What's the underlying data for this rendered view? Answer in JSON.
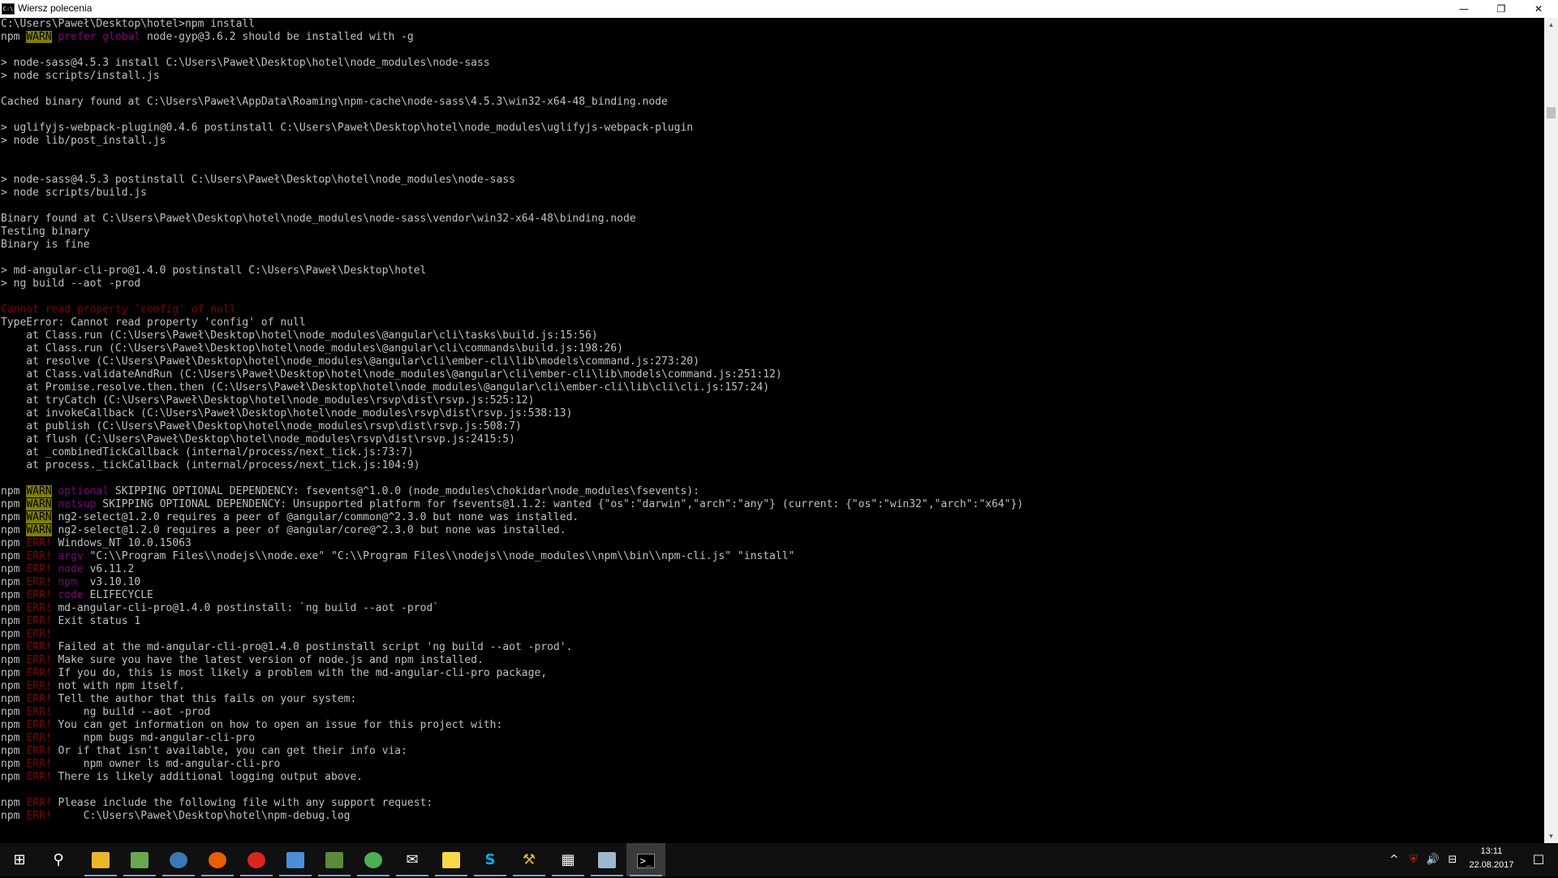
{
  "window": {
    "title": "Wiersz polecenia",
    "icon_text": "C:\\",
    "minimize_glyph": "—",
    "restore_glyph": "❐",
    "close_glyph": "✕"
  },
  "console_lines": [
    [
      {
        "t": "C:\\Users\\Paweł\\Desktop\\hotel>npm install"
      }
    ],
    [
      {
        "t": "npm "
      },
      {
        "t": "WARN",
        "c": "warn"
      },
      {
        "t": " prefer global",
        "c": "mag"
      },
      {
        "t": " node-gyp@3.6.2 should be installed with -g"
      }
    ],
    [
      {
        "t": ""
      }
    ],
    [
      {
        "t": "> node-sass@4.5.3 install C:\\Users\\Paweł\\Desktop\\hotel\\node_modules\\node-sass"
      }
    ],
    [
      {
        "t": "> node scripts/install.js"
      }
    ],
    [
      {
        "t": ""
      }
    ],
    [
      {
        "t": "Cached binary found at C:\\Users\\Paweł\\AppData\\Roaming\\npm-cache\\node-sass\\4.5.3\\win32-x64-48_binding.node"
      }
    ],
    [
      {
        "t": ""
      }
    ],
    [
      {
        "t": "> uglifyjs-webpack-plugin@0.4.6 postinstall C:\\Users\\Paweł\\Desktop\\hotel\\node_modules\\uglifyjs-webpack-plugin"
      }
    ],
    [
      {
        "t": "> node lib/post_install.js"
      }
    ],
    [
      {
        "t": ""
      }
    ],
    [
      {
        "t": ""
      }
    ],
    [
      {
        "t": "> node-sass@4.5.3 postinstall C:\\Users\\Paweł\\Desktop\\hotel\\node_modules\\node-sass"
      }
    ],
    [
      {
        "t": "> node scripts/build.js"
      }
    ],
    [
      {
        "t": ""
      }
    ],
    [
      {
        "t": "Binary found at C:\\Users\\Paweł\\Desktop\\hotel\\node_modules\\node-sass\\vendor\\win32-x64-48\\binding.node"
      }
    ],
    [
      {
        "t": "Testing binary"
      }
    ],
    [
      {
        "t": "Binary is fine"
      }
    ],
    [
      {
        "t": ""
      }
    ],
    [
      {
        "t": "> md-angular-cli-pro@1.4.0 postinstall C:\\Users\\Paweł\\Desktop\\hotel"
      }
    ],
    [
      {
        "t": "> ng build --aot -prod"
      }
    ],
    [
      {
        "t": ""
      }
    ],
    [
      {
        "t": "Cannot read property 'config' of null",
        "c": "red"
      }
    ],
    [
      {
        "t": "TypeError: Cannot read property 'config' of null"
      }
    ],
    [
      {
        "t": "    at Class.run (C:\\Users\\Paweł\\Desktop\\hotel\\node_modules\\@angular\\cli\\tasks\\build.js:15:56)"
      }
    ],
    [
      {
        "t": "    at Class.run (C:\\Users\\Paweł\\Desktop\\hotel\\node_modules\\@angular\\cli\\commands\\build.js:198:26)"
      }
    ],
    [
      {
        "t": "    at resolve (C:\\Users\\Paweł\\Desktop\\hotel\\node_modules\\@angular\\cli\\ember-cli\\lib\\models\\command.js:273:20)"
      }
    ],
    [
      {
        "t": "    at Class.validateAndRun (C:\\Users\\Paweł\\Desktop\\hotel\\node_modules\\@angular\\cli\\ember-cli\\lib\\models\\command.js:251:12)"
      }
    ],
    [
      {
        "t": "    at Promise.resolve.then.then (C:\\Users\\Paweł\\Desktop\\hotel\\node_modules\\@angular\\cli\\ember-cli\\lib\\cli\\cli.js:157:24)"
      }
    ],
    [
      {
        "t": "    at tryCatch (C:\\Users\\Paweł\\Desktop\\hotel\\node_modules\\rsvp\\dist\\rsvp.js:525:12)"
      }
    ],
    [
      {
        "t": "    at invokeCallback (C:\\Users\\Paweł\\Desktop\\hotel\\node_modules\\rsvp\\dist\\rsvp.js:538:13)"
      }
    ],
    [
      {
        "t": "    at publish (C:\\Users\\Paweł\\Desktop\\hotel\\node_modules\\rsvp\\dist\\rsvp.js:508:7)"
      }
    ],
    [
      {
        "t": "    at flush (C:\\Users\\Paweł\\Desktop\\hotel\\node_modules\\rsvp\\dist\\rsvp.js:2415:5)"
      }
    ],
    [
      {
        "t": "    at _combinedTickCallback (internal/process/next_tick.js:73:7)"
      }
    ],
    [
      {
        "t": "    at process._tickCallback (internal/process/next_tick.js:104:9)"
      }
    ],
    [
      {
        "t": ""
      }
    ],
    [
      {
        "t": "npm "
      },
      {
        "t": "WARN",
        "c": "warn"
      },
      {
        "t": " optional",
        "c": "mag"
      },
      {
        "t": " SKIPPING OPTIONAL DEPENDENCY: fsevents@^1.0.0 (node_modules\\chokidar\\node_modules\\fsevents):"
      }
    ],
    [
      {
        "t": "npm "
      },
      {
        "t": "WARN",
        "c": "warn"
      },
      {
        "t": " notsup",
        "c": "mag"
      },
      {
        "t": " SKIPPING OPTIONAL DEPENDENCY: Unsupported platform for fsevents@1.1.2: wanted {\"os\":\"darwin\",\"arch\":\"any\"} (current: {\"os\":\"win32\",\"arch\":\"x64\"})"
      }
    ],
    [
      {
        "t": "npm "
      },
      {
        "t": "WARN",
        "c": "warn"
      },
      {
        "t": " ng2-select@1.2.0 requires a peer of @angular/common@^2.3.0 but none was installed."
      }
    ],
    [
      {
        "t": "npm "
      },
      {
        "t": "WARN",
        "c": "warn"
      },
      {
        "t": " ng2-select@1.2.0 requires a peer of @angular/core@^2.3.0 but none was installed."
      }
    ],
    [
      {
        "t": "npm "
      },
      {
        "t": "ERR!",
        "c": "err"
      },
      {
        "t": " Windows_NT 10.0.15063"
      }
    ],
    [
      {
        "t": "npm "
      },
      {
        "t": "ERR!",
        "c": "err"
      },
      {
        "t": " argv",
        "c": "mag"
      },
      {
        "t": " \"C:\\\\Program Files\\\\nodejs\\\\node.exe\" \"C:\\\\Program Files\\\\nodejs\\\\node_modules\\\\npm\\\\bin\\\\npm-cli.js\" \"install\""
      }
    ],
    [
      {
        "t": "npm "
      },
      {
        "t": "ERR!",
        "c": "err"
      },
      {
        "t": " node",
        "c": "mag"
      },
      {
        "t": " v6.11.2"
      }
    ],
    [
      {
        "t": "npm "
      },
      {
        "t": "ERR!",
        "c": "err"
      },
      {
        "t": " npm ",
        "c": "mag"
      },
      {
        "t": " v3.10.10"
      }
    ],
    [
      {
        "t": "npm "
      },
      {
        "t": "ERR!",
        "c": "err"
      },
      {
        "t": " code",
        "c": "mag"
      },
      {
        "t": " ELIFECYCLE"
      }
    ],
    [
      {
        "t": "npm "
      },
      {
        "t": "ERR!",
        "c": "err"
      },
      {
        "t": " md-angular-cli-pro@1.4.0 postinstall: `ng build --aot -prod`"
      }
    ],
    [
      {
        "t": "npm "
      },
      {
        "t": "ERR!",
        "c": "err"
      },
      {
        "t": " Exit status 1"
      }
    ],
    [
      {
        "t": "npm "
      },
      {
        "t": "ERR!",
        "c": "err"
      }
    ],
    [
      {
        "t": "npm "
      },
      {
        "t": "ERR!",
        "c": "err"
      },
      {
        "t": " Failed at the md-angular-cli-pro@1.4.0 postinstall script 'ng build --aot -prod'."
      }
    ],
    [
      {
        "t": "npm "
      },
      {
        "t": "ERR!",
        "c": "err"
      },
      {
        "t": " Make sure you have the latest version of node.js and npm installed."
      }
    ],
    [
      {
        "t": "npm "
      },
      {
        "t": "ERR!",
        "c": "err"
      },
      {
        "t": " If you do, this is most likely a problem with the md-angular-cli-pro package,"
      }
    ],
    [
      {
        "t": "npm "
      },
      {
        "t": "ERR!",
        "c": "err"
      },
      {
        "t": " not with npm itself."
      }
    ],
    [
      {
        "t": "npm "
      },
      {
        "t": "ERR!",
        "c": "err"
      },
      {
        "t": " Tell the author that this fails on your system:"
      }
    ],
    [
      {
        "t": "npm "
      },
      {
        "t": "ERR!",
        "c": "err"
      },
      {
        "t": "     ng build --aot -prod"
      }
    ],
    [
      {
        "t": "npm "
      },
      {
        "t": "ERR!",
        "c": "err"
      },
      {
        "t": " You can get information on how to open an issue for this project with:"
      }
    ],
    [
      {
        "t": "npm "
      },
      {
        "t": "ERR!",
        "c": "err"
      },
      {
        "t": "     npm bugs md-angular-cli-pro"
      }
    ],
    [
      {
        "t": "npm "
      },
      {
        "t": "ERR!",
        "c": "err"
      },
      {
        "t": " Or if that isn't available, you can get their info via:"
      }
    ],
    [
      {
        "t": "npm "
      },
      {
        "t": "ERR!",
        "c": "err"
      },
      {
        "t": "     npm owner ls md-angular-cli-pro"
      }
    ],
    [
      {
        "t": "npm "
      },
      {
        "t": "ERR!",
        "c": "err"
      },
      {
        "t": " There is likely additional logging output above."
      }
    ],
    [
      {
        "t": ""
      }
    ],
    [
      {
        "t": "npm "
      },
      {
        "t": "ERR!",
        "c": "err"
      },
      {
        "t": " Please include the following file with any support request:"
      }
    ],
    [
      {
        "t": "npm "
      },
      {
        "t": "ERR!",
        "c": "err"
      },
      {
        "t": "     C:\\Users\\Paweł\\Desktop\\hotel\\npm-debug.log"
      }
    ]
  ],
  "colors": {
    "console_bg": "#000000",
    "console_fg": "#c0c0c0",
    "warn_bg": "#808000",
    "err_fg": "#800000",
    "magenta_fg": "#800080",
    "taskbar_bg": "#101010"
  },
  "scrollbar": {
    "up_glyph": "▲",
    "down_glyph": "▼"
  },
  "taskbar": {
    "apps": [
      {
        "name": "start-icon",
        "glyph": "⊞",
        "color": "#ffffff"
      },
      {
        "name": "search-icon",
        "glyph": "⚲",
        "color": "#ffffff"
      },
      {
        "name": "file-explorer-icon",
        "glyph": "",
        "color": "#e8b82a"
      },
      {
        "name": "notepad-icon",
        "glyph": "",
        "color": "#6aa84f"
      },
      {
        "name": "browser-icon",
        "glyph": "",
        "color": "#3b78b5"
      },
      {
        "name": "firefox-icon",
        "glyph": "",
        "color": "#e66000"
      },
      {
        "name": "avira-icon",
        "glyph": "",
        "color": "#d9261c"
      },
      {
        "name": "box-app-icon",
        "glyph": "",
        "color": "#4a90d9"
      },
      {
        "name": "installer-icon",
        "glyph": "",
        "color": "#5a8a3a"
      },
      {
        "name": "chrome-icon",
        "glyph": "",
        "color": "#4caf50"
      },
      {
        "name": "mail-icon",
        "glyph": "✉",
        "color": "#ffffff"
      },
      {
        "name": "sticky-notes-icon",
        "glyph": "",
        "color": "#f7d84a"
      },
      {
        "name": "skype-icon",
        "glyph": "S",
        "color": "#00aff0"
      },
      {
        "name": "tools-icon",
        "glyph": "⚒",
        "color": "#e0b040"
      },
      {
        "name": "calculator-icon",
        "glyph": "▦",
        "color": "#ffffff"
      },
      {
        "name": "network-app-icon",
        "glyph": "",
        "color": "#9fb7cc"
      },
      {
        "name": "command-prompt-icon",
        "glyph": ">_",
        "color": "#ffffff"
      }
    ],
    "tray": {
      "chevron": "^",
      "antivirus": "⛨",
      "volume": "🔊",
      "network": "⊟",
      "time": "13:11",
      "date": "22.08.2017",
      "notifications": "☐"
    }
  }
}
